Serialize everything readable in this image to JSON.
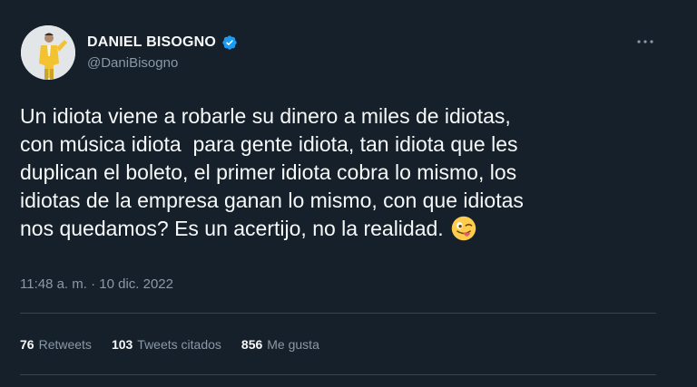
{
  "author": {
    "display_name": "DANIEL BISOGNO",
    "handle": "@DaniBisogno",
    "verified_icon": "verified-badge-icon",
    "avatar_icon": "profile-avatar"
  },
  "more_icon": "more-options-icon",
  "tweet": {
    "text": "Un idiota viene a robarle su dinero a miles de idiotas,\ncon música idiota  para gente idiota, tan idiota que les\nduplican el boleto, el primer idiota cobra lo mismo, los\nidiotas de la empresa ganan lo mismo, con que idiotas\nnos quedamos? Es un acertijo, no la realidad.",
    "emoji_icon": "winking-face-with-tongue-emoji",
    "timestamp": "11:48 a. m. · 10 dic. 2022"
  },
  "stats": [
    {
      "count": "76",
      "label": "Retweets"
    },
    {
      "count": "103",
      "label": "Tweets citados"
    },
    {
      "count": "856",
      "label": "Me gusta"
    }
  ],
  "colors": {
    "background": "#15202b",
    "text_primary": "#f7f9f9",
    "text_secondary": "#8b98a5",
    "verified_blue": "#1d9bf0",
    "divider": "#38444d"
  }
}
